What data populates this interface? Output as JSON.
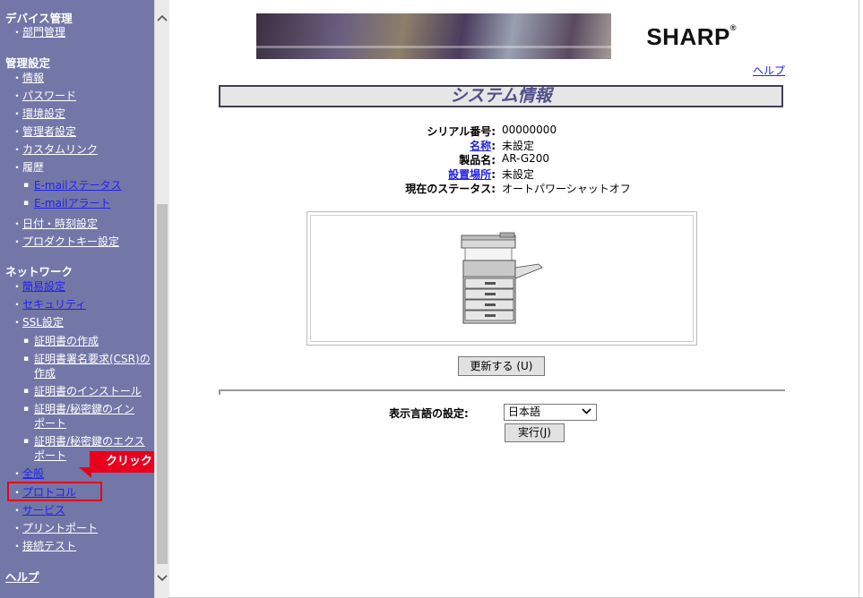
{
  "sidebar": {
    "device": {
      "heading": "デバイス管理",
      "items": [
        "部門管理"
      ]
    },
    "admin": {
      "heading": "管理設定",
      "items": [
        "情報",
        "パスワード",
        "環境設定",
        "管理者設定",
        "カスタムリンク",
        "履歴"
      ],
      "history_sub": [
        "E-mailステータス",
        "E-mailアラート"
      ],
      "items2": [
        "日付・時刻設定",
        "プロダクトキー設定"
      ]
    },
    "network": {
      "heading": "ネットワーク",
      "items": [
        "簡易設定",
        "セキュリティ",
        "SSL設定"
      ],
      "ssl_sub": {
        "create_cert": "証明書の作成",
        "csr_line1": "証明書署名要求(CSR)の",
        "csr_line2": "作成",
        "install_cert": "証明書のインストール",
        "import_line1": "証明書/秘密鍵のイン",
        "import_line2": "ポート",
        "export_line1": "証明書/秘密鍵のエクス",
        "export_line2": "ポート"
      },
      "items2": [
        "全般",
        "プロトコル",
        "サービス",
        "プリントポート",
        "接続テスト"
      ]
    },
    "help": "ヘルプ"
  },
  "callout": {
    "label": "クリック"
  },
  "banner": {
    "logo": "SHARP"
  },
  "header": {
    "help_link": "ヘルプ"
  },
  "page": {
    "title": "システム情報"
  },
  "info": {
    "serial_label": "シリアル番号:",
    "serial_value": "00000000",
    "name_label": "名称",
    "name_value": "未設定",
    "model_label": "製品名:",
    "model_value": "AR-G200",
    "location_label": "設置場所",
    "location_value": "未設定",
    "status_label": "現在のステータス:",
    "status_value": "オートパワーシャットオフ"
  },
  "buttons": {
    "refresh": "更新する (U)",
    "run": "実行(J)"
  },
  "language": {
    "label": "表示言語の設定:",
    "selected": "日本語"
  },
  "colors": {
    "sidebar_bg": "#7377a8",
    "highlight": "#e8001e",
    "link": "#2222ee"
  }
}
